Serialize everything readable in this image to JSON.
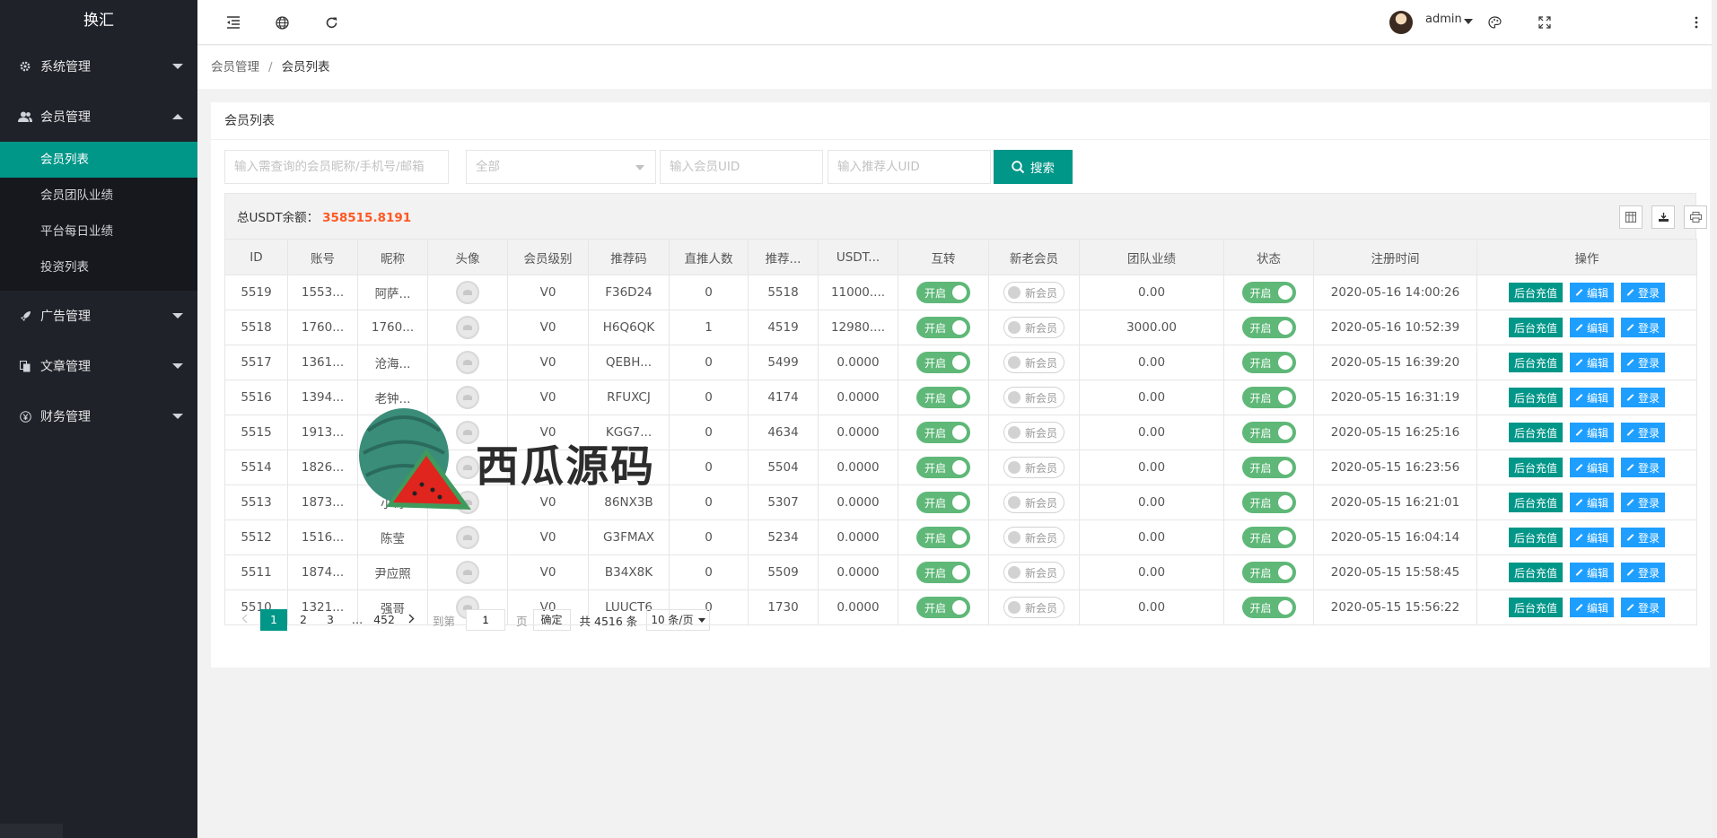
{
  "app": {
    "title": "换汇"
  },
  "sidebar": {
    "groups": [
      {
        "label": "系统管理",
        "icon": "gear-icon",
        "expanded": false
      },
      {
        "label": "会员管理",
        "icon": "users-icon",
        "expanded": true,
        "items": [
          "会员列表",
          "会员团队业绩",
          "平台每日业绩",
          "投资列表"
        ]
      },
      {
        "label": "广告管理",
        "icon": "rocket-icon",
        "expanded": false
      },
      {
        "label": "文章管理",
        "icon": "copy-icon",
        "expanded": false
      },
      {
        "label": "财务管理",
        "icon": "yen-icon",
        "expanded": false
      }
    ],
    "active_item": "会员列表"
  },
  "header": {
    "user": "admin"
  },
  "breadcrumb": [
    "会员管理",
    "会员列表"
  ],
  "card": {
    "title": "会员列表"
  },
  "search": {
    "keyword_placeholder": "输入需查询的会员昵称/手机号/邮箱",
    "level_select": "全部",
    "uid_placeholder": "输入会员UID",
    "referrer_placeholder": "输入推荐人UID",
    "search_label": "搜索"
  },
  "summary": {
    "label": "总USDT余额：",
    "value": "358515.8191"
  },
  "table": {
    "headers": [
      "ID",
      "账号",
      "昵称",
      "头像",
      "会员级别",
      "推荐码",
      "直推人数",
      "推荐...",
      "USDT...",
      "互转",
      "新老会员",
      "团队业绩",
      "状态",
      "注册时间",
      "操作"
    ],
    "switch_on_label": "开启",
    "new_member_label": "新会员",
    "recharge_label": "后台充值",
    "edit_label": "编辑",
    "login_label": "登录",
    "rows": [
      {
        "id": "5519",
        "account": "1553...",
        "nickname": "阿萨...",
        "level": "V0",
        "code": "F36D24",
        "direct": "0",
        "ref": "5518",
        "usdt": "11000....",
        "team": "0.00",
        "time": "2020-05-16 14:00:26"
      },
      {
        "id": "5518",
        "account": "1760...",
        "nickname": "1760...",
        "level": "V0",
        "code": "H6Q6QK",
        "direct": "1",
        "ref": "4519",
        "usdt": "12980....",
        "team": "3000.00",
        "time": "2020-05-16 10:52:39"
      },
      {
        "id": "5517",
        "account": "1361...",
        "nickname": "沧海...",
        "level": "V0",
        "code": "QEBH...",
        "direct": "0",
        "ref": "5499",
        "usdt": "0.0000",
        "team": "0.00",
        "time": "2020-05-15 16:39:20"
      },
      {
        "id": "5516",
        "account": "1394...",
        "nickname": "老钟...",
        "level": "V0",
        "code": "RFUXCJ",
        "direct": "0",
        "ref": "4174",
        "usdt": "0.0000",
        "team": "0.00",
        "time": "2020-05-15 16:31:19"
      },
      {
        "id": "5515",
        "account": "1913...",
        "nickname": "",
        "level": "V0",
        "code": "KGG7...",
        "direct": "0",
        "ref": "4634",
        "usdt": "0.0000",
        "team": "0.00",
        "time": "2020-05-15 16:25:16"
      },
      {
        "id": "5514",
        "account": "1826...",
        "nickname": "",
        "level": "",
        "code": "",
        "direct": "0",
        "ref": "5504",
        "usdt": "0.0000",
        "team": "0.00",
        "time": "2020-05-15 16:23:56"
      },
      {
        "id": "5513",
        "account": "1873...",
        "nickname": "小哥",
        "level": "V0",
        "code": "86NX3B",
        "direct": "0",
        "ref": "5307",
        "usdt": "0.0000",
        "team": "0.00",
        "time": "2020-05-15 16:21:01"
      },
      {
        "id": "5512",
        "account": "1516...",
        "nickname": "陈莹",
        "level": "V0",
        "code": "G3FMAX",
        "direct": "0",
        "ref": "5234",
        "usdt": "0.0000",
        "team": "0.00",
        "time": "2020-05-15 16:04:14"
      },
      {
        "id": "5511",
        "account": "1874...",
        "nickname": "尹应照",
        "level": "V0",
        "code": "B34X8K",
        "direct": "0",
        "ref": "5509",
        "usdt": "0.0000",
        "team": "0.00",
        "time": "2020-05-15 15:58:45"
      },
      {
        "id": "5510",
        "account": "1321...",
        "nickname": "强哥",
        "level": "V0",
        "code": "LUUCT6",
        "direct": "0",
        "ref": "1730",
        "usdt": "0.0000",
        "team": "0.00",
        "time": "2020-05-15 15:56:22"
      }
    ]
  },
  "pagination": {
    "pages": [
      "1",
      "2",
      "3"
    ],
    "ellipsis": "…",
    "last": "452",
    "goto_label": "到第",
    "goto_value": "1",
    "page_unit": "页",
    "confirm_label": "确定",
    "total_text": "共 4516 条",
    "page_size": "10 条/页"
  },
  "watermark": {
    "text": "西瓜源码"
  },
  "colors": {
    "accent": "#009688",
    "blue": "#1e9fff",
    "switch_on": "#5fb878",
    "highlight": "#ff5722"
  }
}
